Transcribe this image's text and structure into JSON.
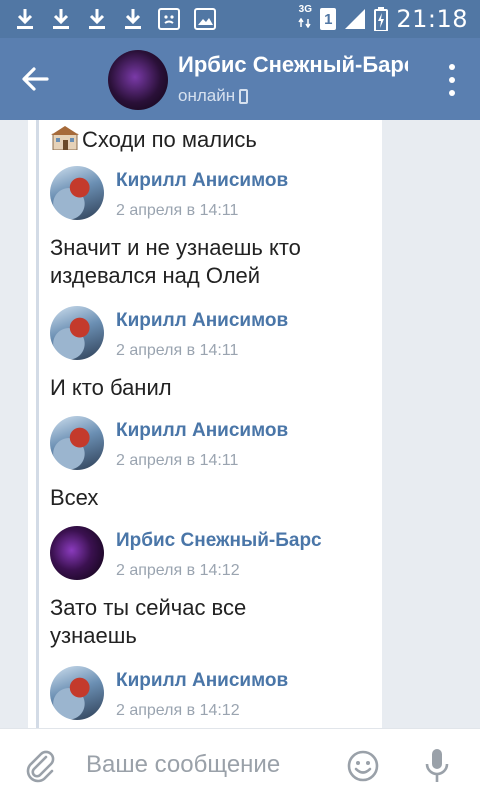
{
  "statusbar": {
    "icons": [
      "download-icon",
      "download-icon",
      "download-icon",
      "download-icon",
      "screenshot-icon",
      "image-icon"
    ],
    "network": "3G",
    "sim": "1",
    "time": "21:18"
  },
  "header": {
    "title": "Ирбис Снежный-Барс",
    "status": "онлайн"
  },
  "messages": [
    {
      "text": "Сходи по мались"
    },
    {
      "author": "Кирилл Анисимов",
      "date": "2 апреля в 14:11",
      "text": "Значит и не узнаешь кто\nиздевался над Олей"
    },
    {
      "author": "Кирилл Анисимов",
      "date": "2 апреля в 14:11",
      "text": "И кто банил"
    },
    {
      "author": "Кирилл Анисимов",
      "date": "2 апреля в 14:11",
      "text": "Всех"
    },
    {
      "author": "Ирбис Снежный-Барс",
      "date": "2 апреля в 14:12",
      "text": "Зато ты сейчас все\nузнаешь"
    },
    {
      "author": "Кирилл Анисимов",
      "date": "2 апреля в 14:12"
    }
  ],
  "input": {
    "placeholder": "Ваше сообщение"
  },
  "colors": {
    "statusbar": "#5177a4",
    "header": "#5a7fb0",
    "author_link": "#4a76a8",
    "chat_background": "#e8ecf1"
  }
}
